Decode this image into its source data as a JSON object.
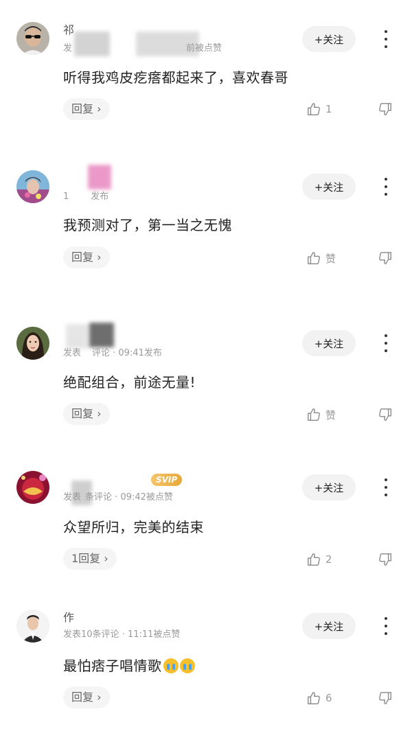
{
  "comments": [
    {
      "name": "祁",
      "meta": "发",
      "meta_tail": "前被点赞",
      "text": "听得我鸡皮疙瘩都起来了，喜欢春哥",
      "follow_label": "+关注",
      "reply_label": "回复 ›",
      "like_count": "1",
      "avatar_icon": "avatar-man-sunglasses"
    },
    {
      "name": "",
      "meta": "1",
      "meta_tail": "发布",
      "text": "我预测对了，第一当之无愧",
      "follow_label": "+关注",
      "reply_label": "回复 ›",
      "like_count": "赞",
      "avatar_icon": "avatar-woman-costume"
    },
    {
      "name": "",
      "meta": "发表",
      "meta_tail": "评论 · 09:41发布",
      "text": "绝配组合，前途无量!",
      "follow_label": "+关注",
      "reply_label": "回复 ›",
      "like_count": "赞",
      "avatar_icon": "avatar-woman-portrait"
    },
    {
      "name": "",
      "badge": "SVIP",
      "meta": "发表",
      "meta_tail": "条评论 · 09:42被点赞",
      "text": "众望所归，完美的结束",
      "follow_label": "+关注",
      "reply_label": "1回复 ›",
      "like_count": "2",
      "avatar_icon": "avatar-festive-logo"
    },
    {
      "name": "作",
      "meta": "发表",
      "meta_tail": "10条评论 · 11:11被点赞",
      "text": "最怕痞子唱情歌",
      "text_emojis": [
        "crying-face-icon",
        "crying-face-icon"
      ],
      "follow_label": "+关注",
      "reply_label": "回复 ›",
      "like_count": "6",
      "avatar_icon": "avatar-man-suit"
    }
  ],
  "colors": {
    "follow_bg": "#f2f2f2",
    "reply_bg": "#f5f5f5",
    "meta_text": "#9a9a9a",
    "svip_gold": "#e8a83a"
  }
}
